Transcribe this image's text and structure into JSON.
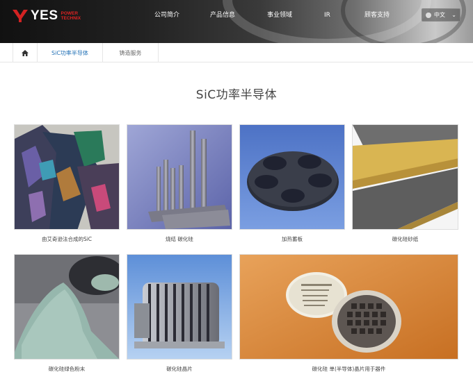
{
  "header": {
    "logo": {
      "brand": "YES",
      "sub_line1": "POWER",
      "sub_line2": "TECHNIX"
    },
    "nav": [
      "公司简介",
      "产品信息",
      "事业领域",
      "IR",
      "顾客支持"
    ],
    "lang": {
      "label": "中文"
    }
  },
  "subnav": {
    "items": [
      "SiC功率半导体",
      "铸造服务"
    ]
  },
  "page": {
    "title": "SiC功率半导体"
  },
  "products": [
    {
      "caption": "由艾奇逊法合成的SiC"
    },
    {
      "caption": "烧结 碳化硅"
    },
    {
      "caption": "加热蓄板"
    },
    {
      "caption": "碳化硅砂纸"
    },
    {
      "caption": "碳化硅绿色粉末"
    },
    {
      "caption": "碳化硅晶片"
    },
    {
      "caption": "碳化硅 单(半导体)晶片用于器件"
    }
  ],
  "colors": {
    "accent": "#1f6fb5",
    "brand_red": "#d22222"
  }
}
